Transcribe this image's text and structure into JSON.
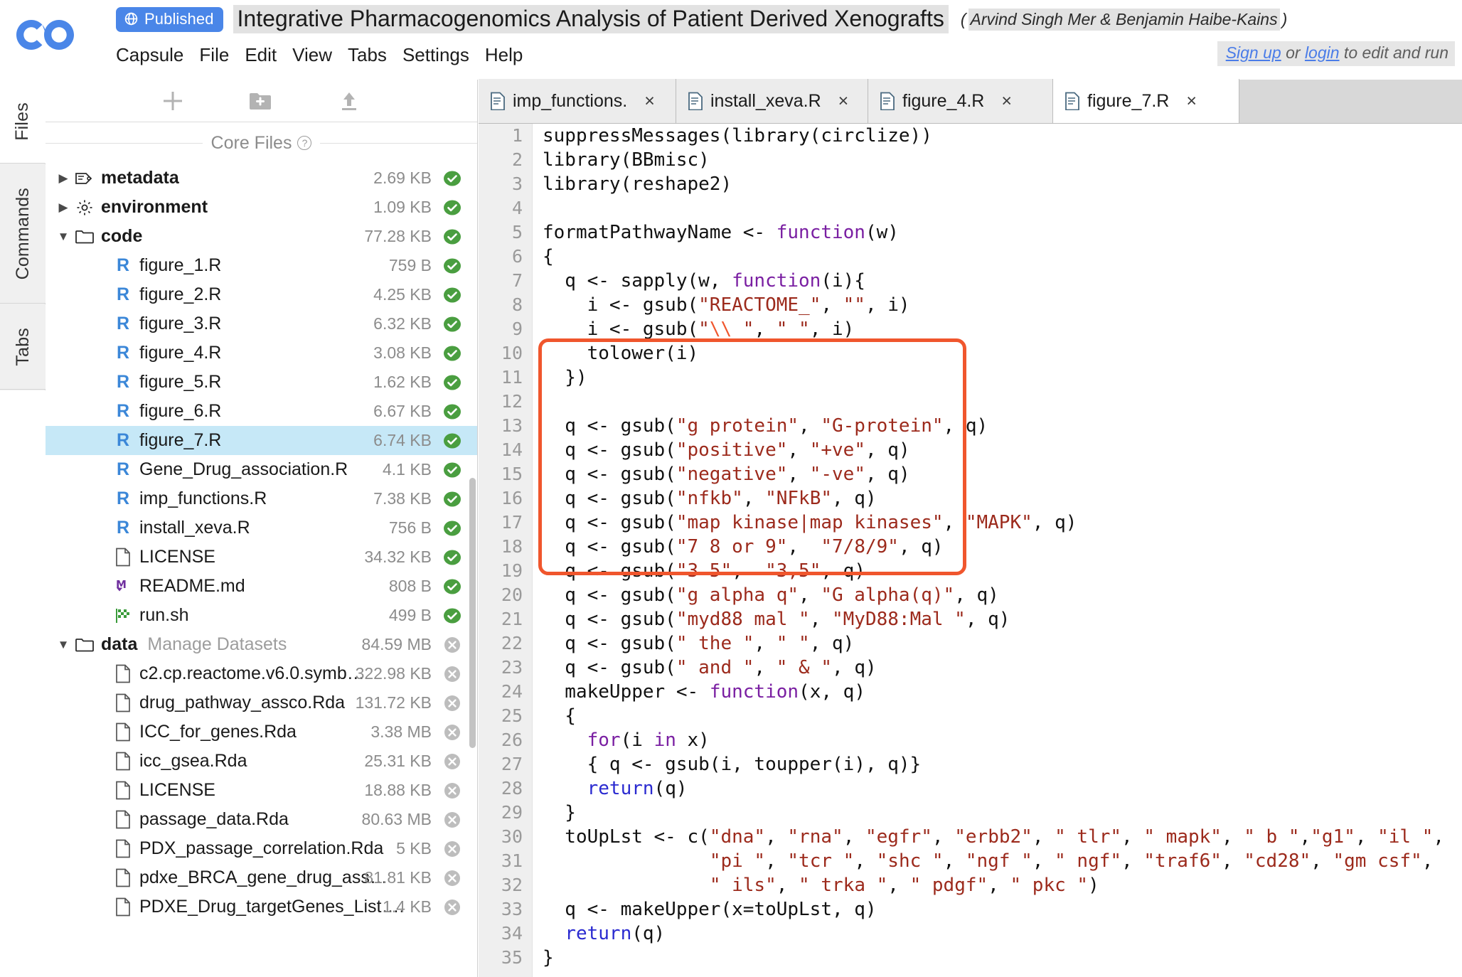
{
  "header": {
    "logo_name": "codeocean-logo",
    "badge": {
      "label": "Published",
      "icon": "globe-icon"
    },
    "capsule_title": "Integrative Pharmacogenomics Analysis of Patient Derived Xenografts",
    "authors_open": "(",
    "authors": "Arvind Singh Mer & Benjamin Haibe-Kains",
    "authors_close": ")",
    "menu": [
      "Capsule",
      "File",
      "Edit",
      "View",
      "Tabs",
      "Settings",
      "Help"
    ],
    "signin": {
      "signup": "Sign up",
      "or": " or ",
      "login": "login",
      "tail": " to edit and run"
    }
  },
  "rail": {
    "tabs": [
      "Files",
      "Commands",
      "Tabs"
    ],
    "active": "Files"
  },
  "file_panel": {
    "toolbar": [
      {
        "name": "add-file-button",
        "icon": "plus-icon"
      },
      {
        "name": "new-folder-button",
        "icon": "folder-plus-icon"
      },
      {
        "name": "upload-button",
        "icon": "upload-icon"
      }
    ],
    "section_label": "Core Files",
    "help_icon": "question-icon",
    "tree": [
      {
        "name": "metadata",
        "size": "2.69 KB",
        "icon": "tag-icon",
        "depth": 1,
        "caret": "collapsed",
        "bold": true,
        "status": "check"
      },
      {
        "name": "environment",
        "size": "1.09 KB",
        "icon": "gear-icon",
        "depth": 1,
        "caret": "collapsed",
        "bold": true,
        "status": "check"
      },
      {
        "name": "code",
        "size": "77.28 KB",
        "icon": "folder-icon",
        "depth": 1,
        "caret": "expanded",
        "bold": true,
        "status": "check"
      },
      {
        "name": "figure_1.R",
        "size": "759 B",
        "icon": "r-icon",
        "depth": 2,
        "status": "check"
      },
      {
        "name": "figure_2.R",
        "size": "4.25 KB",
        "icon": "r-icon",
        "depth": 2,
        "status": "check"
      },
      {
        "name": "figure_3.R",
        "size": "6.32 KB",
        "icon": "r-icon",
        "depth": 2,
        "status": "check"
      },
      {
        "name": "figure_4.R",
        "size": "3.08 KB",
        "icon": "r-icon",
        "depth": 2,
        "status": "check"
      },
      {
        "name": "figure_5.R",
        "size": "1.62 KB",
        "icon": "r-icon",
        "depth": 2,
        "status": "check"
      },
      {
        "name": "figure_6.R",
        "size": "6.67 KB",
        "icon": "r-icon",
        "depth": 2,
        "status": "check"
      },
      {
        "name": "figure_7.R",
        "size": "6.74 KB",
        "icon": "r-icon",
        "depth": 2,
        "status": "check",
        "selected": true
      },
      {
        "name": "Gene_Drug_association.R",
        "size": "4.1 KB",
        "icon": "r-icon",
        "depth": 2,
        "status": "check"
      },
      {
        "name": "imp_functions.R",
        "size": "7.38 KB",
        "icon": "r-icon",
        "depth": 2,
        "status": "check"
      },
      {
        "name": "install_xeva.R",
        "size": "756 B",
        "icon": "r-icon",
        "depth": 2,
        "status": "check"
      },
      {
        "name": "LICENSE",
        "size": "34.32 KB",
        "icon": "file-icon",
        "depth": 2,
        "status": "check"
      },
      {
        "name": "README.md",
        "size": "808 B",
        "icon": "md-icon",
        "depth": 2,
        "status": "check"
      },
      {
        "name": "run.sh",
        "size": "499 B",
        "icon": "flag-icon",
        "depth": 2,
        "status": "check"
      },
      {
        "name": "data",
        "sub": "Manage Datasets",
        "size": "84.59 MB",
        "icon": "folder-icon",
        "depth": 1,
        "caret": "expanded",
        "bold": true,
        "status": "x"
      },
      {
        "name": "c2.cp.reactome.v6.0.symb…",
        "size": "322.98 KB",
        "icon": "file-icon",
        "depth": 2,
        "status": "x"
      },
      {
        "name": "drug_pathway_assco.Rda",
        "size": "131.72 KB",
        "icon": "file-icon",
        "depth": 2,
        "status": "x"
      },
      {
        "name": "ICC_for_genes.Rda",
        "size": "3.38 MB",
        "icon": "file-icon",
        "depth": 2,
        "status": "x"
      },
      {
        "name": "icc_gsea.Rda",
        "size": "25.31 KB",
        "icon": "file-icon",
        "depth": 2,
        "status": "x"
      },
      {
        "name": "LICENSE",
        "size": "18.88 KB",
        "icon": "file-icon",
        "depth": 2,
        "status": "x"
      },
      {
        "name": "passage_data.Rda",
        "size": "80.63 MB",
        "icon": "file-icon",
        "depth": 2,
        "status": "x"
      },
      {
        "name": "PDX_passage_correlation.Rda",
        "size": "5 KB",
        "icon": "file-icon",
        "depth": 2,
        "status": "x"
      },
      {
        "name": "pdxe_BRCA_gene_drug_ass…",
        "size": "81.81 KB",
        "icon": "file-icon",
        "depth": 2,
        "status": "x"
      },
      {
        "name": "PDXE_Drug_targetGenes_List….",
        "size": "1.4 KB",
        "icon": "file-icon",
        "depth": 2,
        "status": "x"
      }
    ]
  },
  "editor": {
    "tabs": [
      {
        "label": "imp_functions.",
        "close": "×",
        "active": false
      },
      {
        "label": "install_xeva.R",
        "close": "×",
        "active": false
      },
      {
        "label": "figure_4.R",
        "close": "×",
        "active": false
      },
      {
        "label": "figure_7.R",
        "close": "×",
        "active": true
      }
    ],
    "first_line": 1,
    "highlight_color": "#f0562d",
    "lines": [
      {
        "n": 1,
        "html": "suppressMessages(library(circlize))"
      },
      {
        "n": 2,
        "html": "library(BBmisc)"
      },
      {
        "n": 3,
        "html": "library(reshape2)"
      },
      {
        "n": 4,
        "html": ""
      },
      {
        "n": 5,
        "html": "formatPathwayName <- <k>function</k>(w)"
      },
      {
        "n": 6,
        "html": "{"
      },
      {
        "n": 7,
        "html": "  q <- sapply(w, <k>function</k>(i){"
      },
      {
        "n": 8,
        "html": "    i <- gsub(<s>\"REACTOME_\"</s>, <s>\"\"</s>, i)"
      },
      {
        "n": 9,
        "html": "    i <- gsub(<s>\"</s><e>\\\\_</e><s>\"</s>, <s>\" \"</s>, i)"
      },
      {
        "n": 10,
        "html": "    tolower(i)"
      },
      {
        "n": 11,
        "html": "  })"
      },
      {
        "n": 12,
        "html": ""
      },
      {
        "n": 13,
        "html": "  q <- gsub(<s>\"g protein\"</s>, <s>\"G-protein\"</s>, q)"
      },
      {
        "n": 14,
        "html": "  q <- gsub(<s>\"positive\"</s>, <s>\"+ve\"</s>, q)"
      },
      {
        "n": 15,
        "html": "  q <- gsub(<s>\"negative\"</s>, <s>\"-ve\"</s>, q)"
      },
      {
        "n": 16,
        "html": "  q <- gsub(<s>\"nfkb\"</s>, <s>\"NFkB\"</s>, q)"
      },
      {
        "n": 17,
        "html": "  q <- gsub(<s>\"map kinase|map kinases\"</s>, <s>\"MAPK\"</s>, q)"
      },
      {
        "n": 18,
        "html": "  q <- gsub(<s>\"7 8 or 9\"</s>,  <s>\"7/8/9\"</s>, q)"
      },
      {
        "n": 19,
        "html": "  q <- gsub(<s>\"3 5\"</s>,  <s>\"3,5\"</s>, q)"
      },
      {
        "n": 20,
        "html": "  q <- gsub(<s>\"g alpha q\"</s>, <s>\"G alpha(q)\"</s>, q)"
      },
      {
        "n": 21,
        "html": "  q <- gsub(<s>\"myd88 mal \"</s>, <s>\"MyD88:Mal \"</s>, q)"
      },
      {
        "n": 22,
        "html": "  q <- gsub(<s>\" the \"</s>, <s>\" \"</s>, q)"
      },
      {
        "n": 23,
        "html": "  q <- gsub(<s>\" and \"</s>, <s>\" &amp; \"</s>, q)"
      },
      {
        "n": 24,
        "html": "  makeUpper <- <k>function</k>(x, q)"
      },
      {
        "n": 25,
        "html": "  {"
      },
      {
        "n": 26,
        "html": "    <k>for</k>(i <k>in</k> x)"
      },
      {
        "n": 27,
        "html": "    { q <- gsub(i, toupper(i), q)}"
      },
      {
        "n": 28,
        "html": "    <b>return</b>(q)"
      },
      {
        "n": 29,
        "html": "  }"
      },
      {
        "n": 30,
        "html": "  toUpLst <- c(<s>\"dna\"</s>, <s>\"rna\"</s>, <s>\"egfr\"</s>, <s>\"erbb2\"</s>, <s>\" tlr\"</s>, <s>\" mapk\"</s>, <s>\" b \"</s>,<s>\"g1\"</s>, <s>\"il \"</s>,"
      },
      {
        "n": 31,
        "html": "               <s>\"pi \"</s>, <s>\"tcr \"</s>, <s>\"shc \"</s>, <s>\"ngf \"</s>, <s>\" ngf\"</s>, <s>\"traf6\"</s>, <s>\"cd28\"</s>, <s>\"gm csf\"</s>,"
      },
      {
        "n": 32,
        "html": "               <s>\" ils\"</s>, <s>\" trka \"</s>, <s>\" pdgf\"</s>, <s>\" pkc \"</s>)"
      },
      {
        "n": 33,
        "html": "  q <- makeUpper(x=toUpLst, q)"
      },
      {
        "n": 34,
        "html": "  <b>return</b>(q)"
      },
      {
        "n": 35,
        "html": "}"
      }
    ]
  }
}
